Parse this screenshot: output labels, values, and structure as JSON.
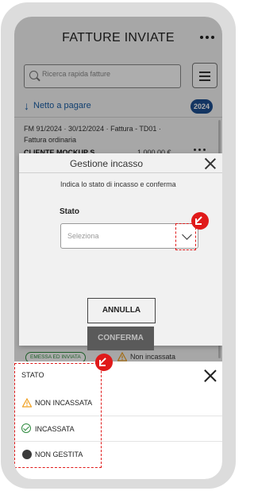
{
  "app": {
    "title": "FATTURE INVIATE",
    "search_placeholder": "Ricerca rapida fatture",
    "sort_label": "Netto a pagare",
    "year_badge": "2024",
    "invoice": {
      "line1": "FM 91/2024 · 30/12/2024 · Fattura - TD01 ·",
      "line2": "Fattura ordinaria",
      "client": "CLIENTE MOCKUP S...",
      "amount": "1.000,00 €"
    },
    "status_row": {
      "badge": "EMESSA ED INVIATA",
      "status_text": "Non incassata"
    }
  },
  "modal": {
    "title": "Gestione incasso",
    "instruction": "Indica lo stato di incasso e conferma",
    "field_label": "Stato",
    "select_placeholder": "Seleziona",
    "cancel_label": "ANNULLA",
    "confirm_label": "CONFERMA"
  },
  "sheet": {
    "title": "STATO",
    "options": [
      {
        "label": "NON INCASSATA",
        "icon": "warning-icon"
      },
      {
        "label": "INCASSATA",
        "icon": "check-circle-icon"
      },
      {
        "label": "NON GESTITA",
        "icon": "filled-circle-icon"
      }
    ]
  },
  "colors": {
    "accent_blue": "#1d4f91",
    "link_blue": "#1a5ea6",
    "success_green": "#2e8b3e",
    "warning_orange": "#f0a020",
    "highlight_red": "#e01a1a"
  }
}
